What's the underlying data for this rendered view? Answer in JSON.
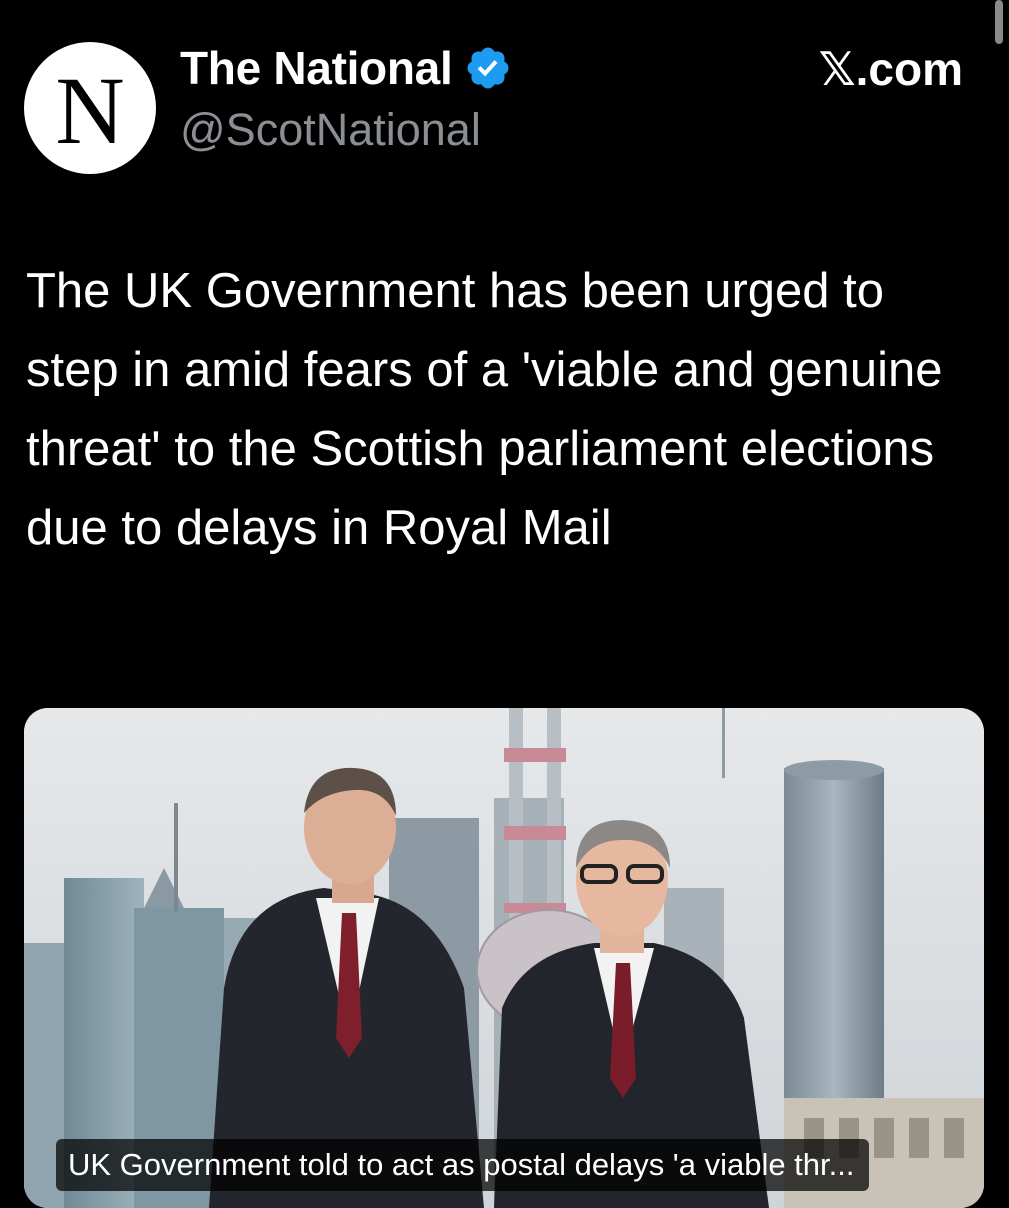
{
  "account": {
    "avatar_letter": "N",
    "display_name": "The National",
    "handle": "@ScotNational",
    "verified": true,
    "verified_color": "#1d9bf0"
  },
  "source": {
    "label": "𝕏.com"
  },
  "post": {
    "text": "The UK Government has been urged to step in amid fears of a 'viable and genuine threat' to the Scottish parliament elections due to delays in Royal Mail"
  },
  "media": {
    "caption": "UK Government told to act as postal delays 'a viable thr..."
  },
  "colors": {
    "background": "#000000",
    "text": "#ffffff",
    "secondary_text": "#8b8f94"
  }
}
